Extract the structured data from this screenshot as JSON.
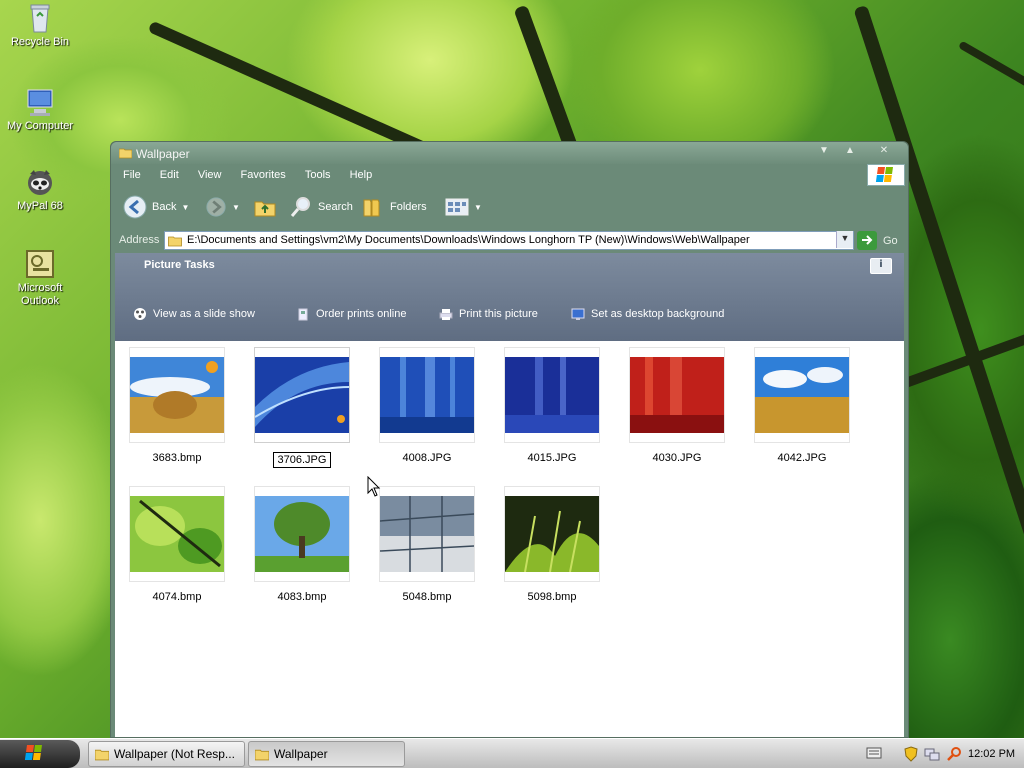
{
  "desktop": {
    "icons": [
      {
        "label": "Recycle Bin"
      },
      {
        "label": "My Computer"
      },
      {
        "label": "MyPal 68"
      },
      {
        "label": "Microsoft Outlook"
      }
    ]
  },
  "window": {
    "title": "Wallpaper",
    "menu": [
      "File",
      "Edit",
      "View",
      "Favorites",
      "Tools",
      "Help"
    ],
    "toolbar": {
      "back_label": "Back",
      "search_label": "Search",
      "folders_label": "Folders"
    },
    "address": {
      "label": "Address",
      "value": "E:\\Documents and Settings\\vm2\\My Documents\\Downloads\\Windows Longhorn TP (New)\\Windows\\Web\\Wallpaper",
      "go_label": "Go"
    },
    "task_pane": {
      "title": "Picture Tasks",
      "info_glyph": "i",
      "items": [
        {
          "label": "View as a slide show",
          "icon": "slideshow-icon"
        },
        {
          "label": "Order prints online",
          "icon": "order-prints-icon"
        },
        {
          "label": "Print this picture",
          "icon": "printer-icon"
        },
        {
          "label": "Set as desktop background",
          "icon": "desktop-background-icon"
        }
      ]
    },
    "files": [
      {
        "name": "3683.bmp"
      },
      {
        "name": "3706.JPG",
        "selected": true,
        "renaming": true
      },
      {
        "name": "4008.JPG"
      },
      {
        "name": "4015.JPG"
      },
      {
        "name": "4030.JPG"
      },
      {
        "name": "4042.JPG"
      },
      {
        "name": "4074.bmp"
      },
      {
        "name": "4083.bmp"
      },
      {
        "name": "5048.bmp"
      },
      {
        "name": "5098.bmp"
      }
    ]
  },
  "taskbar": {
    "tasks": [
      {
        "label": "Wallpaper (Not Resp..."
      },
      {
        "label": "Wallpaper",
        "active": true
      }
    ],
    "clock": "12:02 PM"
  }
}
